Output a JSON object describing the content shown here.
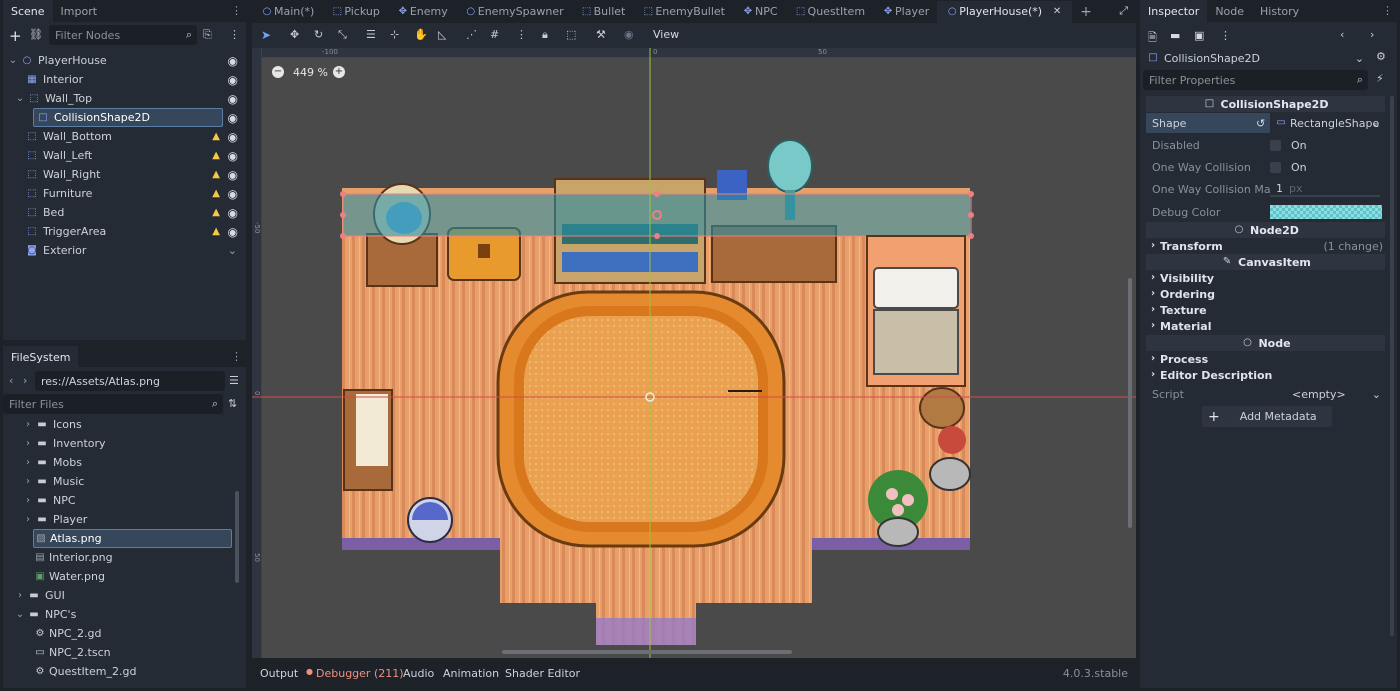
{
  "left_dock": {
    "tabs": [
      {
        "label": "Scene"
      },
      {
        "label": "Import"
      }
    ],
    "filter_placeholder": "Filter Nodes",
    "tree": [
      {
        "label": "PlayerHouse",
        "icon": "node2d-icon",
        "warn": false,
        "vis": "eye"
      },
      {
        "label": "Interior",
        "icon": "tilemap-icon",
        "warn": false,
        "vis": "eye"
      },
      {
        "label": "Wall_Top",
        "icon": "staticbody-icon",
        "warn": false,
        "vis": "eye"
      },
      {
        "label": "CollisionShape2D",
        "icon": "collisionshape-icon",
        "warn": false,
        "vis": "eye"
      },
      {
        "label": "Wall_Bottom",
        "icon": "staticbody-icon",
        "warn": true,
        "vis": "eye"
      },
      {
        "label": "Wall_Left",
        "icon": "staticbody-icon",
        "warn": true,
        "vis": "eye"
      },
      {
        "label": "Wall_Right",
        "icon": "staticbody-icon",
        "warn": true,
        "vis": "eye"
      },
      {
        "label": "Furniture",
        "icon": "staticbody-icon",
        "warn": true,
        "vis": "eye"
      },
      {
        "label": "Bed",
        "icon": "staticbody-icon",
        "warn": true,
        "vis": "eye"
      },
      {
        "label": "TriggerArea",
        "icon": "area-icon",
        "warn": true,
        "vis": "eye"
      },
      {
        "label": "Exterior",
        "icon": "scene-instance-icon",
        "warn": false,
        "vis": "chevron"
      }
    ]
  },
  "filesystem": {
    "title": "FileSystem",
    "path": "res://Assets/Atlas.png",
    "filter_placeholder": "Filter Files",
    "items": [
      {
        "label": "Icons",
        "type": "folder"
      },
      {
        "label": "Inventory",
        "type": "folder"
      },
      {
        "label": "Mobs",
        "type": "folder"
      },
      {
        "label": "Music",
        "type": "folder"
      },
      {
        "label": "NPC",
        "type": "folder"
      },
      {
        "label": "Player",
        "type": "folder"
      },
      {
        "label": "Atlas.png",
        "type": "image"
      },
      {
        "label": "Interior.png",
        "type": "image"
      },
      {
        "label": "Water.png",
        "type": "image"
      },
      {
        "label": "GUI",
        "type": "folder"
      },
      {
        "label": "NPC's",
        "type": "folder"
      },
      {
        "label": "NPC_2.gd",
        "type": "script"
      },
      {
        "label": "NPC_2.tscn",
        "type": "scene"
      },
      {
        "label": "QuestItem_2.gd",
        "type": "script"
      }
    ]
  },
  "scene_tabs": [
    {
      "label": "Main(*)",
      "icon": "node-icon"
    },
    {
      "label": "Pickup",
      "icon": "area-icon"
    },
    {
      "label": "Enemy",
      "icon": "body-icon"
    },
    {
      "label": "EnemySpawner",
      "icon": "node-icon"
    },
    {
      "label": "Bullet",
      "icon": "area-icon"
    },
    {
      "label": "EnemyBullet",
      "icon": "area-icon"
    },
    {
      "label": "NPC",
      "icon": "body-icon"
    },
    {
      "label": "QuestItem",
      "icon": "area-icon"
    },
    {
      "label": "Player",
      "icon": "body-icon"
    },
    {
      "label": "PlayerHouse(*)",
      "icon": "node-icon"
    }
  ],
  "toolbar": {
    "view_label": "View"
  },
  "viewport": {
    "zoom": "449 %",
    "ruler_top": [
      "-100",
      "0",
      "50"
    ],
    "ruler_left": [
      "-50",
      "0",
      "50"
    ]
  },
  "bottom_bar": {
    "tabs": [
      {
        "label": "Output"
      },
      {
        "label": "Debugger (211)"
      },
      {
        "label": "Audio"
      },
      {
        "label": "Animation"
      },
      {
        "label": "Shader Editor"
      }
    ],
    "version": "4.0.3.stable"
  },
  "inspector": {
    "tabs": [
      {
        "label": "Inspector"
      },
      {
        "label": "Node"
      },
      {
        "label": "History"
      }
    ],
    "object": "CollisionShape2D",
    "filter_placeholder": "Filter Properties",
    "section_title": "CollisionShape2D",
    "shape_label": "Shape",
    "shape_value": "RectangleShape",
    "disabled_label": "Disabled",
    "disabled_value": "On",
    "oneway_label": "One Way Collision",
    "oneway_value": "On",
    "margin_label": "One Way Collision Ma...",
    "margin_value": "1",
    "margin_unit": "px",
    "debug_color_label": "Debug Color",
    "node2d_title": "Node2D",
    "transform_label": "Transform",
    "transform_note": "(1 change)",
    "canvasitem_title": "CanvasItem",
    "canvas_cats": [
      "Visibility",
      "Ordering",
      "Texture",
      "Material"
    ],
    "node_title": "Node",
    "node_cats": [
      "Process",
      "Editor Description"
    ],
    "script_label": "Script",
    "script_value": "<empty>",
    "add_metadata": "Add Metadata"
  }
}
